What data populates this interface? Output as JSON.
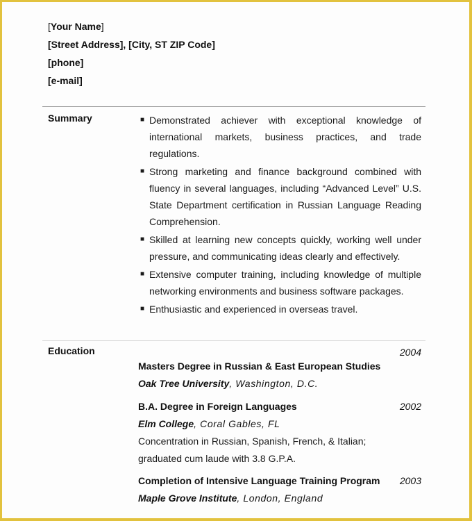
{
  "colors": {
    "border": "#e2c23e",
    "text": "#111111",
    "divider": "#9a9a9a"
  },
  "header": {
    "name_open": "[",
    "name": "Your Name",
    "name_close": "]",
    "address": "[Street Address], [City, ST  ZIP Code]",
    "phone": "[phone]",
    "email": "[e-mail]"
  },
  "summary": {
    "label": "Summary",
    "bullet_glyph": "■",
    "items": [
      "Demonstrated achiever with exceptional knowledge of international markets, business practices, and trade regulations.",
      "Strong marketing and finance background combined with fluency in several languages, including “Advanced Level” U.S. State Department certification in Russian Language Reading Comprehension.",
      "Skilled at learning new concepts quickly, working well under pressure, and communicating ideas clearly and effectively.",
      "Extensive computer training, including knowledge of multiple networking environments and business software packages.",
      "Enthusiastic and experienced in overseas travel."
    ]
  },
  "education": {
    "label": "Education",
    "entries": [
      {
        "degree": "Masters Degree in Russian & East European Studies",
        "year": "2004",
        "school": "Oak Tree University",
        "location": ", Washington, D.C.",
        "notes": []
      },
      {
        "degree": "B.A. Degree in Foreign Languages",
        "year": "2002",
        "school": "Elm College",
        "location": ", Coral Gables, FL",
        "notes": [
          "Concentration in Russian, Spanish, French, & Italian;",
          "graduated cum laude with 3.8 G.P.A."
        ]
      },
      {
        "degree": "Completion of Intensive Language Training Program",
        "year": "2003",
        "school": "Maple Grove Institute",
        "location": ", London, England",
        "notes": []
      }
    ]
  }
}
